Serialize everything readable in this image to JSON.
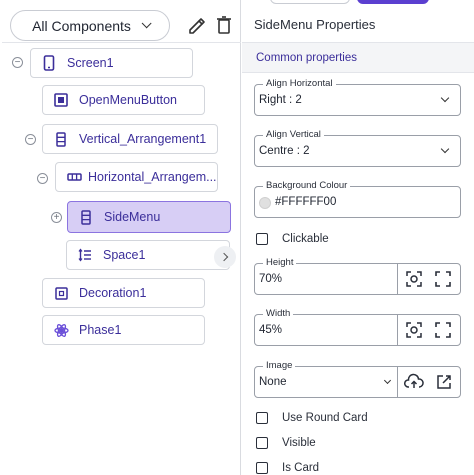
{
  "components_panel": {
    "filter_label": "All Components",
    "tree": [
      {
        "label": "Screen1",
        "icon": "phone-icon"
      },
      {
        "label": "OpenMenuButton",
        "icon": "button-icon"
      },
      {
        "label": "Vertical_Arrangement1",
        "icon": "vertical-arrangement-icon"
      },
      {
        "label": "Horizontal_Arrangem...",
        "icon": "horizontal-arrangement-icon"
      },
      {
        "label": "SideMenu",
        "icon": "vertical-arrangement-icon"
      },
      {
        "label": "Space1",
        "icon": "space-icon"
      },
      {
        "label": "Decoration1",
        "icon": "decoration-icon"
      },
      {
        "label": "Phase1",
        "icon": "phase-icon"
      }
    ]
  },
  "properties": {
    "title": "SideMenu Properties",
    "section": "Common properties",
    "align_horizontal": {
      "label": "Align Horizontal",
      "value": "Right : 2"
    },
    "align_vertical": {
      "label": "Align Vertical",
      "value": "Centre : 2"
    },
    "background_colour": {
      "label": "Background Colour",
      "value": "#FFFFFF00"
    },
    "clickable": {
      "label": "Clickable"
    },
    "height": {
      "label": "Height",
      "value": "70%"
    },
    "width": {
      "label": "Width",
      "value": "45%"
    },
    "image": {
      "label": "Image",
      "value": "None"
    },
    "use_round_card": {
      "label": "Use Round Card"
    },
    "visible": {
      "label": "Visible"
    },
    "is_card": {
      "label": "Is Card"
    }
  },
  "colors": {
    "accent": "#5b3fd0",
    "selected_bg": "#d7cef5",
    "tree_text": "#3b2e9a"
  }
}
